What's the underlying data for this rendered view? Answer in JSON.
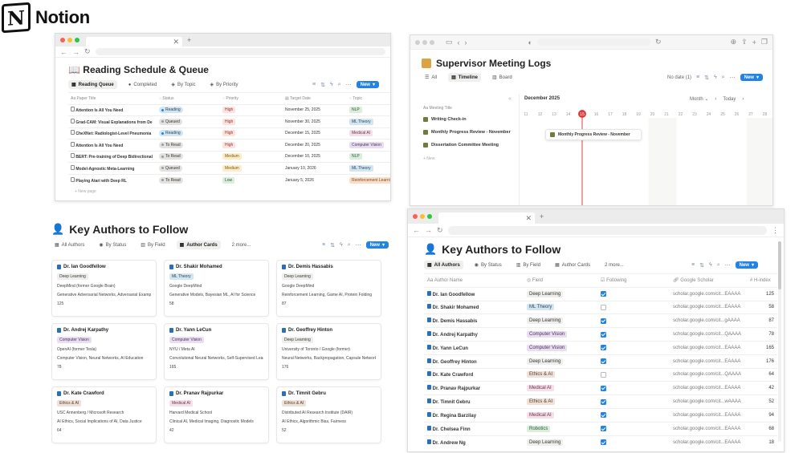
{
  "brand": {
    "name": "Notion",
    "logo_letter": "N"
  },
  "reading": {
    "title": "📖 Reading Schedule & Queue",
    "views": [
      "Reading Queue",
      "Completed",
      "By Topic",
      "By Priority"
    ],
    "new_label": "New",
    "columns": [
      "Paper Title",
      "Status",
      "Priority",
      "Target Date",
      "Topic"
    ],
    "rows": [
      {
        "title": "Attention Is All You Need",
        "status": "Reading",
        "priority": "High",
        "date": "November 25, 2025",
        "topic": "NLP"
      },
      {
        "title": "Grad-CAM: Visual Explanations from De",
        "status": "Queued",
        "priority": "High",
        "date": "November 30, 2025",
        "topic": "ML Theory"
      },
      {
        "title": "CheXNet: Radiologist-Level Pneumonia",
        "status": "Reading",
        "priority": "High",
        "date": "December 15, 2025",
        "topic": "Medical AI"
      },
      {
        "title": "Attention Is All You Need",
        "status": "To Read",
        "priority": "High",
        "date": "December 20, 2025",
        "topic": "Computer Vision"
      },
      {
        "title": "BERT: Pre-training of Deep Bidirectional",
        "status": "To Read",
        "priority": "Medium",
        "date": "December 10, 2025",
        "topic": "NLP"
      },
      {
        "title": "Model-Agnostic Meta-Learning",
        "status": "Queued",
        "priority": "Medium",
        "date": "January 10, 2026",
        "topic": "ML Theory"
      },
      {
        "title": "Playing Atari with Deep RL",
        "status": "To Read",
        "priority": "Low",
        "date": "January 5, 2026",
        "topic": "Reinforcement Learning"
      }
    ],
    "new_page": "+ New page"
  },
  "meetings": {
    "title": "Supervisor Meeting Logs",
    "views": [
      "All",
      "Timeline",
      "Board"
    ],
    "no_date": "No date (1)",
    "new_label": "New",
    "month_label": "December 2025",
    "month_btn": "Month",
    "today_btn": "Today",
    "days": [
      "11",
      "12",
      "13",
      "14",
      "15",
      "16",
      "17",
      "18",
      "19",
      "20",
      "21",
      "22",
      "23",
      "24",
      "25",
      "26",
      "27",
      "28"
    ],
    "today_day": "15",
    "col_label": "Meeting Title",
    "items": [
      "Writing Check-in",
      "Monthly Progress Review - November",
      "Dissertation Committee Meeting"
    ],
    "new_row": "+ New",
    "bar_label": "Monthly Progress Review - November"
  },
  "authors_cards": {
    "title": "Key Authors to Follow",
    "views": [
      "All Authors",
      "By Status",
      "By Field",
      "Author Cards",
      "2 more..."
    ],
    "new_label": "New",
    "cards": [
      {
        "name": "Dr. Ian Goodfellow",
        "tag": "Deep Learning",
        "affil": "DeepMind (former Google Brain)",
        "interests": "Generative Adversarial Networks, Adversarial Examples",
        "h": "125"
      },
      {
        "name": "Dr. Shakir Mohamed",
        "tag": "ML Theory",
        "affil": "Google DeepMind",
        "interests": "Generative Models, Bayesian ML, AI for Science",
        "h": "58"
      },
      {
        "name": "Dr. Demis Hassabis",
        "tag": "Deep Learning",
        "affil": "Google DeepMind",
        "interests": "Reinforcement Learning, Game AI, Protein Folding",
        "h": "87"
      },
      {
        "name": "Dr. Andrej Karpathy",
        "tag": "Computer Vision",
        "affil": "OpenAI (former Tesla)",
        "interests": "Computer Vision, Neural Networks, AI Education",
        "h": "78"
      },
      {
        "name": "Dr. Yann LeCun",
        "tag": "Computer Vision",
        "affil": "NYU / Meta AI",
        "interests": "Convolutional Neural Networks, Self-Supervised Learning",
        "h": "165"
      },
      {
        "name": "Dr. Geoffrey Hinton",
        "tag": "Deep Learning",
        "affil": "University of Toronto / Google (former)",
        "interests": "Neural Networks, Backpropagation, Capsule Networks",
        "h": "176"
      },
      {
        "name": "Dr. Kate Crawford",
        "tag": "Ethics & AI",
        "affil": "USC Annenberg / Microsoft Research",
        "interests": "AI Ethics, Social Implications of AI, Data Justice",
        "h": "64"
      },
      {
        "name": "Dr. Pranav Rajpurkar",
        "tag": "Medical AI",
        "affil": "Harvard Medical School",
        "interests": "Clinical AI, Medical Imaging, Diagnostic Models",
        "h": "42"
      },
      {
        "name": "Dr. Timnit Gebru",
        "tag": "Ethics & AI",
        "affil": "Distributed AI Research Institute (DAIR)",
        "interests": "AI Ethics, Algorithmic Bias, Fairness",
        "h": "52"
      }
    ]
  },
  "authors_table": {
    "title": "Key Authors to Follow",
    "views": [
      "All Authors",
      "By Status",
      "By Field",
      "Author Cards",
      "2 more..."
    ],
    "new_label": "New",
    "columns": [
      "Author Name",
      "Field",
      "Following",
      "Google Scholar",
      "H-index"
    ],
    "rows": [
      {
        "name": "Dr. Ian Goodfellow",
        "field": "Deep Learning",
        "following": true,
        "scholar": "scholar.google.com/cit...EAAAA",
        "h": "125"
      },
      {
        "name": "Dr. Shakir Mohamed",
        "field": "ML Theory",
        "following": false,
        "scholar": "scholar.google.com/cit...EAAAA",
        "h": "58"
      },
      {
        "name": "Dr. Demis Hassabis",
        "field": "Deep Learning",
        "following": true,
        "scholar": "scholar.google.com/cit...gAAAA",
        "h": "87"
      },
      {
        "name": "Dr. Andrej Karpathy",
        "field": "Computer Vision",
        "following": true,
        "scholar": "scholar.google.com/cit...QAAAA",
        "h": "78"
      },
      {
        "name": "Dr. Yann LeCun",
        "field": "Computer Vision",
        "following": true,
        "scholar": "scholar.google.com/cit...EAAAA",
        "h": "165"
      },
      {
        "name": "Dr. Geoffrey Hinton",
        "field": "Deep Learning",
        "following": true,
        "scholar": "scholar.google.com/cit...EAAAA",
        "h": "176"
      },
      {
        "name": "Dr. Kate Crawford",
        "field": "Ethics & AI",
        "following": false,
        "scholar": "scholar.google.com/cit...QAAAA",
        "h": "64"
      },
      {
        "name": "Dr. Pranav Rajpurkar",
        "field": "Medical AI",
        "following": true,
        "scholar": "scholar.google.com/cit...EAAAA",
        "h": "42"
      },
      {
        "name": "Dr. Timnit Gebru",
        "field": "Ethics & AI",
        "following": true,
        "scholar": "scholar.google.com/cit...wAAAA",
        "h": "52"
      },
      {
        "name": "Dr. Regina Barzilay",
        "field": "Medical AI",
        "following": true,
        "scholar": "scholar.google.com/cit...EAAAA",
        "h": "94"
      },
      {
        "name": "Dr. Chelsea Finn",
        "field": "Robotics",
        "following": true,
        "scholar": "scholar.google.com/cit...EAAAA",
        "h": "68"
      },
      {
        "name": "Dr. Andrew Ng",
        "field": "Deep Learning",
        "following": true,
        "scholar": "scholar.google.com/cit...EAAAA",
        "h": "18"
      }
    ]
  },
  "colors": {
    "accent": "#2383e2",
    "today": "#e03e3e",
    "tags": {
      "NLP": [
        "#dbeddb",
        "#2b593f"
      ],
      "ML Theory": [
        "#d3e5ef",
        "#28456c"
      ],
      "Medical AI": [
        "#f5e0e9",
        "#69314c"
      ],
      "Computer Vision": [
        "#e8deee",
        "#492f64"
      ],
      "Reinforcement Learning": [
        "#fadec9",
        "#854c1d"
      ],
      "Deep Learning": [
        "#eeeeed",
        "#37352f"
      ],
      "Ethics & AI": [
        "#eee0da",
        "#5c3b23"
      ],
      "Robotics": [
        "#dbeddb",
        "#2b593f"
      ],
      "High": [
        "#ffe2dd",
        "#7d3a3a"
      ],
      "Medium": [
        "#fdecc8",
        "#7a5a14"
      ],
      "Low": [
        "#dbeddb",
        "#2b593f"
      ],
      "Reading": [
        "#d3e5ef",
        "#28456c"
      ],
      "Queued": [
        "#e3e2e0",
        "#37352f"
      ],
      "To Read": [
        "#e3e2e0",
        "#37352f"
      ]
    },
    "status_dots": {
      "Reading": "#2383e2",
      "Queued": "#9b9a97",
      "To Read": "#9b9a97"
    }
  }
}
